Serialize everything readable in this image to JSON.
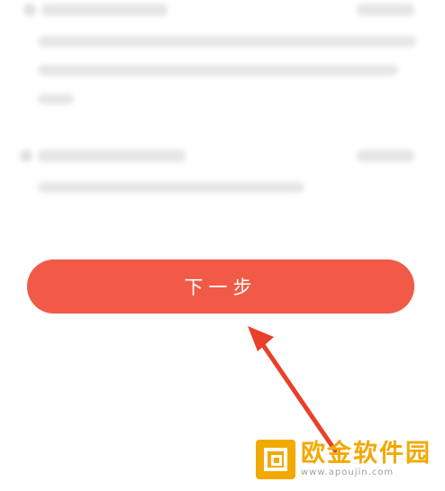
{
  "next_button": {
    "label": "下一步",
    "color": "#f05a47"
  },
  "annotation": {
    "arrow_color": "#e8402b"
  },
  "watermark": {
    "title": "欧金软件园",
    "url": "www.apoujin.com",
    "accent": "#f2a900"
  }
}
